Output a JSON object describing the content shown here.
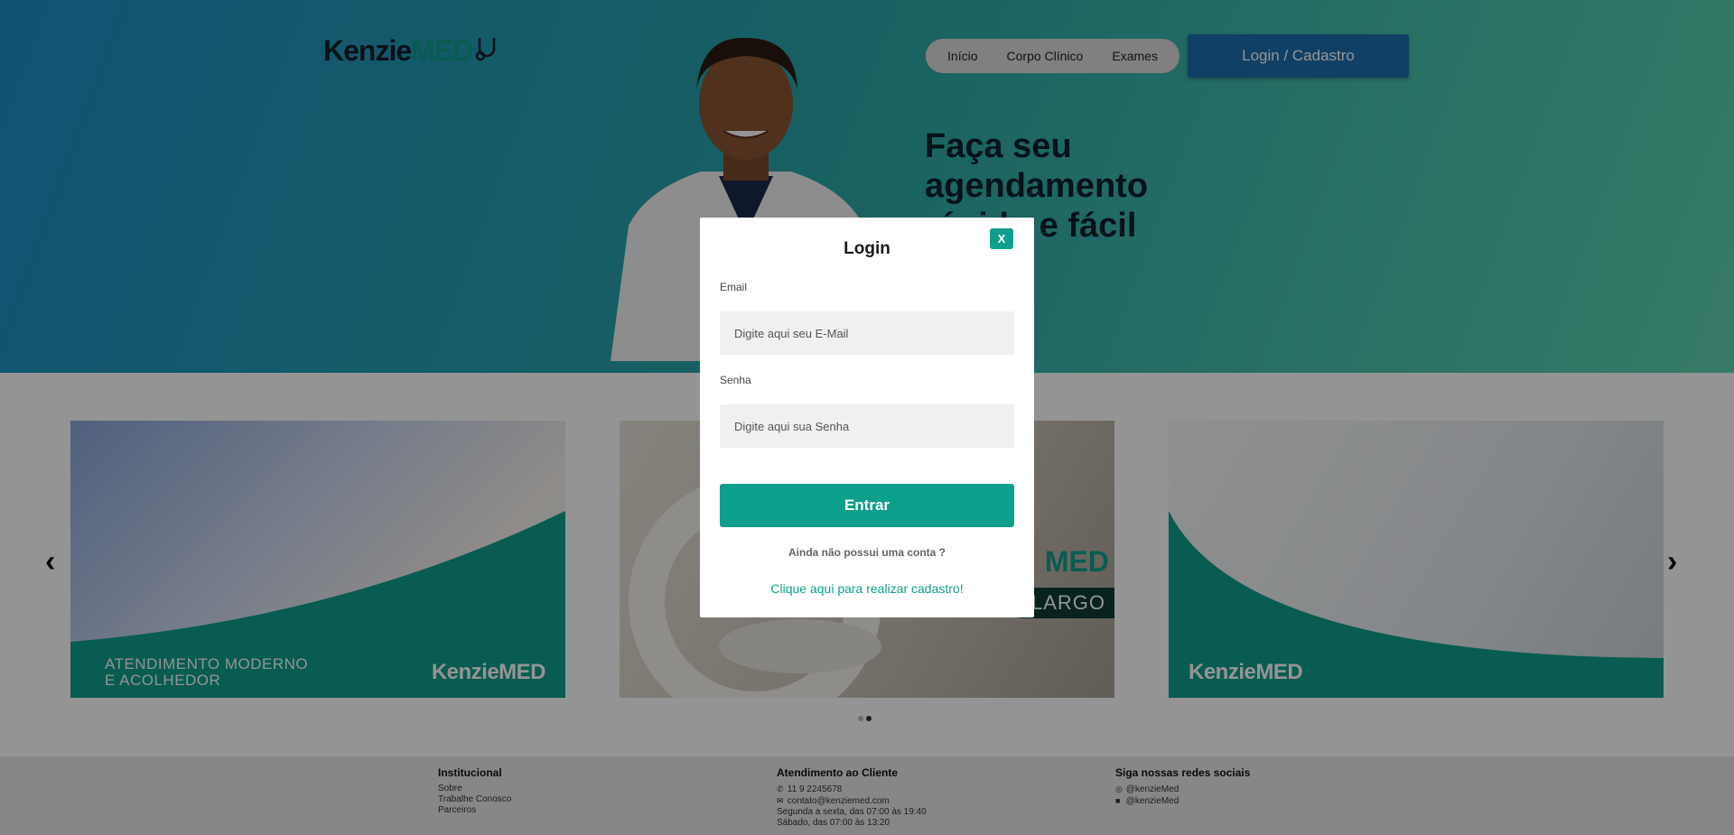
{
  "header": {
    "logo_part1": "Kenzie",
    "logo_part2": "MED",
    "nav": [
      {
        "label": "Início"
      },
      {
        "label": "Corpo Clínico"
      },
      {
        "label": "Exames"
      }
    ],
    "login_button": "Login / Cadastro"
  },
  "hero": {
    "headline": "Faça seu agendamento rápido e fácil"
  },
  "carousel": {
    "slides": [
      {
        "caption_line1": "ATENDIMENTO MODERNO",
        "caption_line2": "E ACOLHEDOR",
        "logo": "KenzieMED"
      },
      {
        "badge": "LARGO",
        "logo": "MED"
      },
      {
        "logo": "KenzieMED"
      }
    ],
    "prev_arrow": "‹",
    "next_arrow": "›",
    "active_dot": 2,
    "dot_count": 2
  },
  "modal": {
    "title": "Login",
    "close_label": "X",
    "email_label": "Email",
    "email_placeholder": "Digite aqui seu E-Mail",
    "password_label": "Senha",
    "password_placeholder": "Digite aqui sua Senha",
    "submit_label": "Entrar",
    "no_account_text": "Ainda não possui uma conta ?",
    "register_link": "Clique aqui para realizar cadastro!"
  },
  "footer": {
    "institutional": {
      "title": "Institucional",
      "links": [
        "Sobre",
        "Trabalhe Conosco",
        "Parceiros"
      ]
    },
    "customer_service": {
      "title": "Atendimento ao Cliente",
      "phone": "11 9 2245678",
      "email": "contato@kenziemed.com",
      "hours_weekday": "Segunda a sexta, das 07:00 às 19:40",
      "hours_saturday": "Sábado, das 07:00 às 13:20"
    },
    "social": {
      "title": "Siga nossas redes sociais",
      "instagram": "@kenzieMed",
      "facebook": "@kenzieMed"
    }
  },
  "colors": {
    "accent": "#0e9f8c",
    "login_button": "#1d6fb0",
    "hero_gradient_start": "#1f8fc7",
    "hero_gradient_end": "#5fd4b1"
  }
}
